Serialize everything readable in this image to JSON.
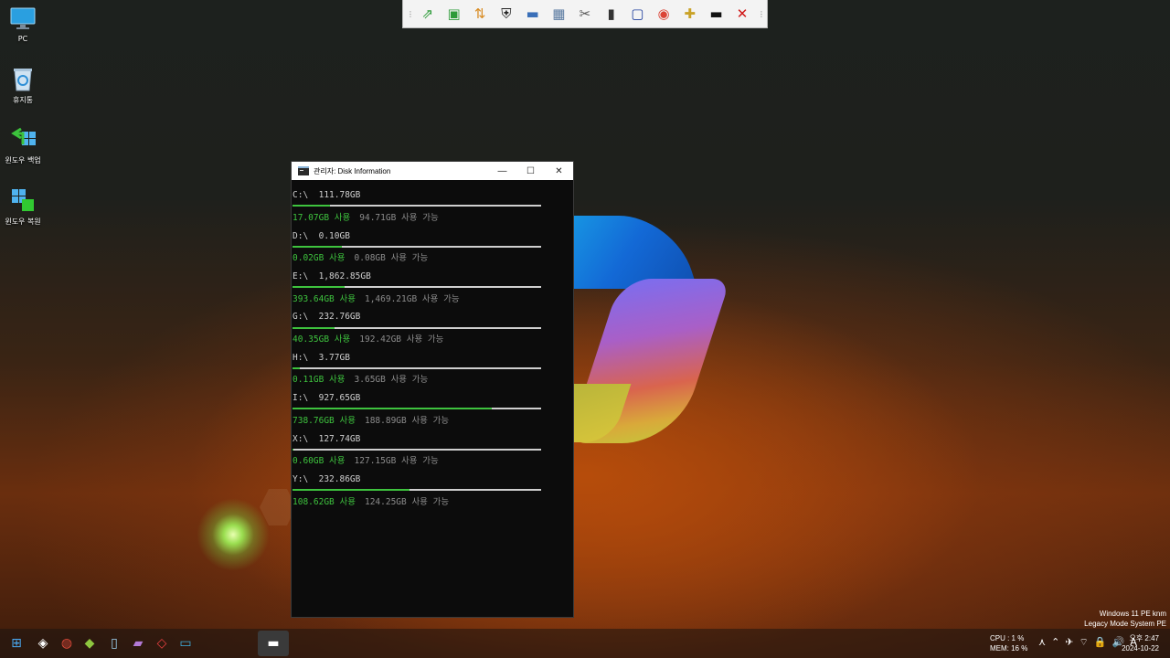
{
  "desktop": {
    "icons": [
      {
        "label": "PC",
        "icon": "monitor-icon"
      },
      {
        "label": "휴지통",
        "icon": "recycle-bin-icon"
      },
      {
        "label": "윈도우 백업",
        "icon": "windows-backup-icon"
      },
      {
        "label": "윈도우 복원",
        "icon": "windows-restore-icon"
      }
    ]
  },
  "toolbar": {
    "buttons": [
      {
        "name": "share-arrow-icon",
        "glyph": "⇗",
        "color": "#2e9b3a"
      },
      {
        "name": "drive-backup-icon",
        "glyph": "▣",
        "color": "#2e9b3a"
      },
      {
        "name": "file-transfer-icon",
        "glyph": "⇅",
        "color": "#d88a20"
      },
      {
        "name": "shield-icon",
        "glyph": "⛨",
        "color": "#222222"
      },
      {
        "name": "network-drive-icon",
        "glyph": "▬",
        "color": "#3a6fb8"
      },
      {
        "name": "partition-icon",
        "glyph": "▦",
        "color": "#5a7aa0"
      },
      {
        "name": "tools-icon",
        "glyph": "✂",
        "color": "#555555"
      },
      {
        "name": "sd-card-icon",
        "glyph": "▮",
        "color": "#333333"
      },
      {
        "name": "monitor-icon",
        "glyph": "▢",
        "color": "#1f3f9e"
      },
      {
        "name": "chrome-icon",
        "glyph": "◉",
        "color": "#db4437"
      },
      {
        "name": "add-folder-icon",
        "glyph": "✚",
        "color": "#c9a227"
      },
      {
        "name": "terminal-icon",
        "glyph": "▬",
        "color": "#111111"
      },
      {
        "name": "close-icon",
        "glyph": "✕",
        "color": "#d01818"
      }
    ]
  },
  "window": {
    "title": "관리자:  Disk Information",
    "minimize": "—",
    "maximize": "☐",
    "close": "✕"
  },
  "drives": [
    {
      "header": "C:\\  111.78GB",
      "used_fraction": 0.15,
      "used": "17.07GB 사용",
      "available": "94.71GB 사용 가능"
    },
    {
      "header": "D:\\  0.10GB",
      "used_fraction": 0.2,
      "used": "0.02GB 사용",
      "available": "0.08GB 사용 가능"
    },
    {
      "header": "E:\\  1,862.85GB",
      "used_fraction": 0.21,
      "used": "393.64GB 사용",
      "available": "1,469.21GB 사용 가능"
    },
    {
      "header": "G:\\  232.76GB",
      "used_fraction": 0.17,
      "used": "40.35GB 사용",
      "available": "192.42GB 사용 가능"
    },
    {
      "header": "H:\\  3.77GB",
      "used_fraction": 0.03,
      "used": "0.11GB 사용",
      "available": "3.65GB 사용 가능"
    },
    {
      "header": "I:\\  927.65GB",
      "used_fraction": 0.8,
      "used": "738.76GB 사용",
      "available": "188.89GB 사용 가능"
    },
    {
      "header": "X:\\  127.74GB",
      "used_fraction": 0.005,
      "used": "0.60GB 사용",
      "available": "127.15GB 사용 가능"
    },
    {
      "header": "Y:\\  232.86GB",
      "used_fraction": 0.47,
      "used": "108.62GB 사용",
      "available": "124.25GB 사용 가능"
    }
  ],
  "taskbar": {
    "apps": [
      {
        "name": "start-icon",
        "glyph": "⊞",
        "color": "#4aa8f0"
      },
      {
        "name": "app-diamond-icon",
        "glyph": "◈",
        "color": "#ffffff"
      },
      {
        "name": "app-globe-icon",
        "glyph": "◍",
        "color": "#e04a3a"
      },
      {
        "name": "app-ps-icon",
        "glyph": "◆",
        "color": "#8ec63f"
      },
      {
        "name": "app-glass-icon",
        "glyph": "▯",
        "color": "#9fd4f5"
      },
      {
        "name": "app-media-icon",
        "glyph": "▰",
        "color": "#b37ad6"
      },
      {
        "name": "app-arrow-icon",
        "glyph": "◇",
        "color": "#e84040"
      },
      {
        "name": "app-folder-icon",
        "glyph": "▭",
        "color": "#3fb0e0"
      }
    ],
    "active_app": {
      "name": "terminal-taskbar-icon",
      "glyph": "▬"
    },
    "cpu": "CPU :   1 %",
    "mem": "MEM:  16 %",
    "tray": [
      "⋏",
      "⌃",
      "✈",
      "⌔",
      "🔒",
      "🔊",
      "A"
    ],
    "time": "오후 2:47",
    "date": "2024-10-22"
  },
  "system_info": {
    "line1": "Windows 11 PE knm",
    "line2": "Legacy Mode System PE"
  }
}
